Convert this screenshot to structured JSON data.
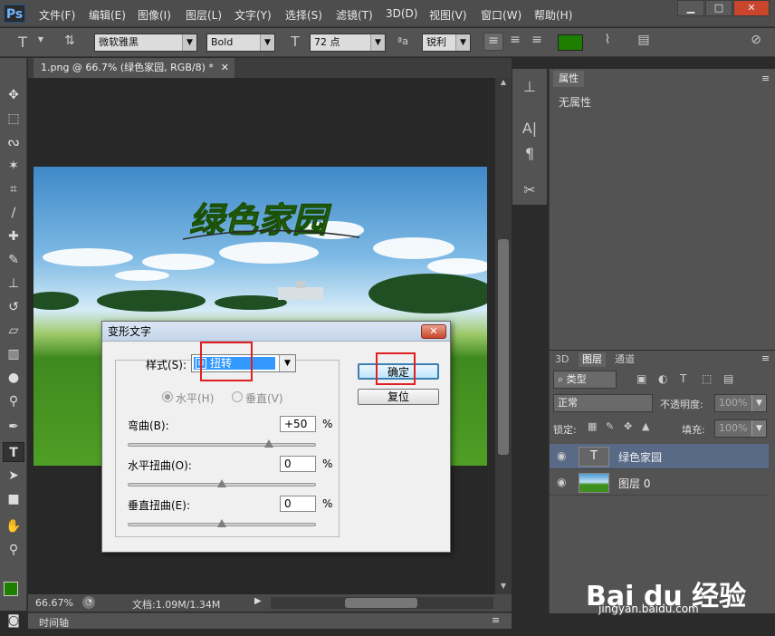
{
  "app": {
    "logo": "Ps"
  },
  "menu": [
    "文件(F)",
    "编辑(E)",
    "图像(I)",
    "图层(L)",
    "文字(Y)",
    "选择(S)",
    "滤镜(T)",
    "3D(D)",
    "视图(V)",
    "窗口(W)",
    "帮助(H)"
  ],
  "window_controls": {
    "minimize": "▁",
    "maximize": "□",
    "close": "✕"
  },
  "options": {
    "font_family": "微软雅黑",
    "font_style": "Bold",
    "font_size": "72 点",
    "aa_label": "ªa",
    "antialias": "锐利",
    "text_color": "#1e7e00"
  },
  "document": {
    "tab_title": "1.png @ 66.7% (绿色家园, RGB/8) *",
    "image_text": "绿色家园",
    "zoom": "66.67%",
    "doc_size": "文档:1.09M/1.34M"
  },
  "timeline": {
    "label": "时间轴"
  },
  "properties": {
    "tab": "属性",
    "empty": "无属性"
  },
  "layers": {
    "tabs": [
      "3D",
      "图层",
      "通道"
    ],
    "filter_label": "类型",
    "blend_mode": "正常",
    "opacity_label": "不透明度:",
    "opacity_value": "100%",
    "lock_label": "锁定:",
    "fill_label": "填充:",
    "fill_value": "100%",
    "items": [
      {
        "name": "绿色家园",
        "type": "text"
      },
      {
        "name": "图层 0",
        "type": "image"
      }
    ]
  },
  "dialog": {
    "title": "变形文字",
    "style_label": "样式(S):",
    "style_value": "扭转",
    "horizontal_label": "水平(H)",
    "vertical_label": "垂直(V)",
    "bend_label": "弯曲(B):",
    "bend_value": "+50",
    "h_distort_label": "水平扭曲(O):",
    "h_distort_value": "0",
    "v_distort_label": "垂直扭曲(E):",
    "v_distort_value": "0",
    "percent": "%",
    "ok_label": "确定",
    "reset_label": "复位",
    "bend_level": 0.75,
    "h_distort_level": 0.5,
    "v_distort_level": 0.5
  },
  "watermark": {
    "brand": "Bai du 经验",
    "url": "jingyan.baidu.com"
  }
}
